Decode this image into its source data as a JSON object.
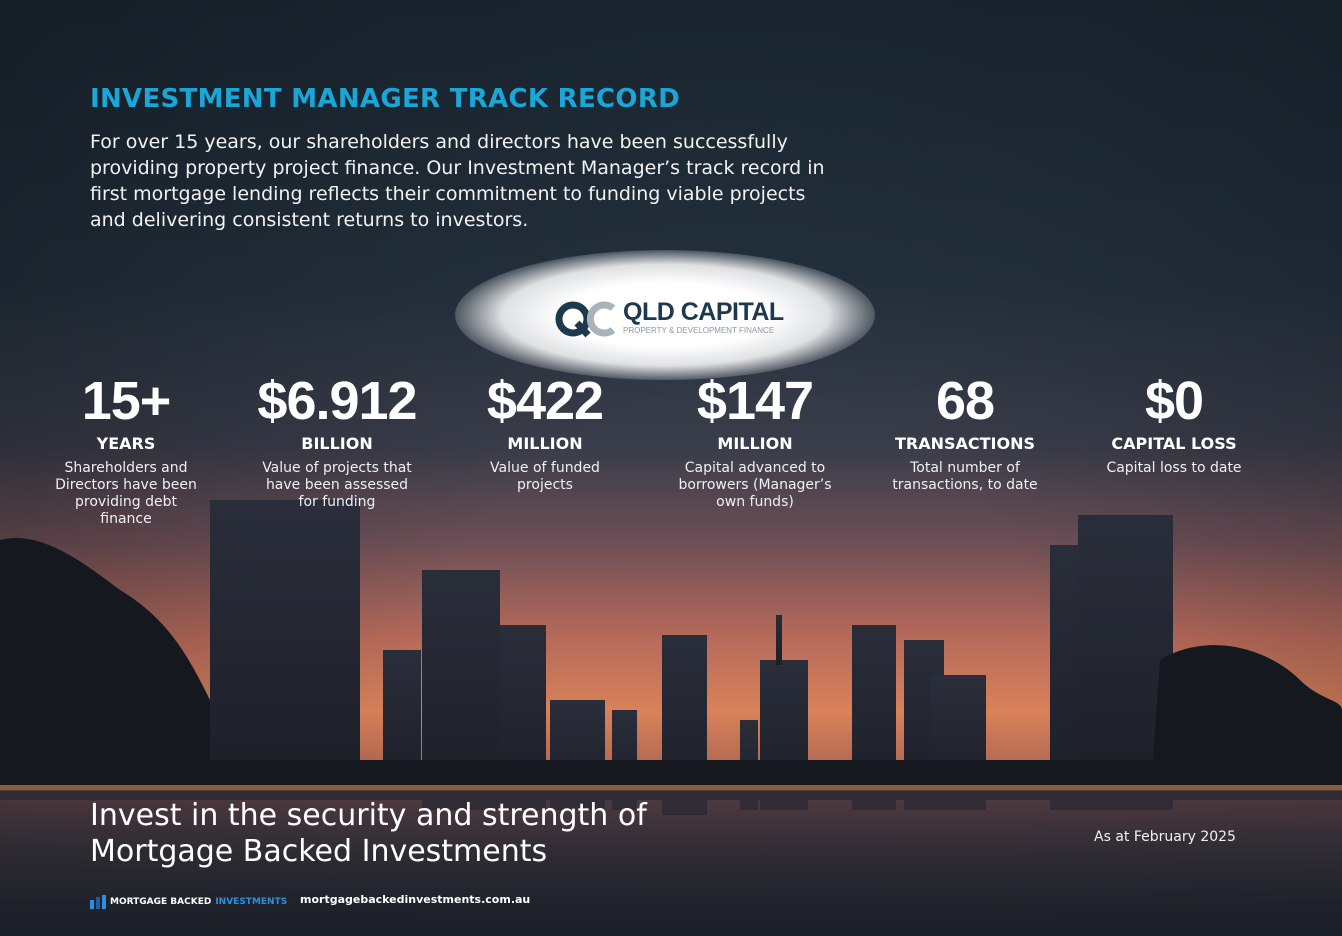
{
  "header": {
    "title": "INVESTMENT MANAGER TRACK RECORD",
    "intro": "For over 15 years, our shareholders and directors have been successfully providing property project finance. Our Investment Manager’s track record in first mortgage lending reflects their commitment to funding viable projects and delivering consistent returns to investors."
  },
  "partner_logo": {
    "name": "QLD CAPITAL",
    "tagline": "PROPERTY & DEVELOPMENT FINANCE"
  },
  "stats": [
    {
      "value": "15+",
      "unit": "YEARS",
      "description": "Shareholders and Directors have been providing  debt finance"
    },
    {
      "value": "$6.912",
      "unit": "BILLION",
      "description": "Value of projects that have been assessed for funding"
    },
    {
      "value": "$422",
      "unit": "MILLION",
      "description": "Value of funded projects"
    },
    {
      "value": "$147",
      "unit": "MILLION",
      "description": "Capital advanced to borrowers (Manager’s own funds)"
    },
    {
      "value": "68",
      "unit": "TRANSACTIONS",
      "description": "Total number of transactions, to date"
    },
    {
      "value": "$0",
      "unit": "CAPITAL LOSS",
      "description": "Capital loss to date"
    }
  ],
  "footer": {
    "tagline_line1": "Invest in the security and strength of",
    "tagline_line2": "Mortgage Backed Investments",
    "as_at": "As at February 2025",
    "brand_part1": "MORTGAGE BACKED",
    "brand_part2": "INVESTMENTS",
    "url": "mortgagebackedinvestments.com.au"
  },
  "colors": {
    "title_accent": "#1aa7d8",
    "logo_navy": "#1d3a4d",
    "brand_blue": "#2c8fe0"
  }
}
